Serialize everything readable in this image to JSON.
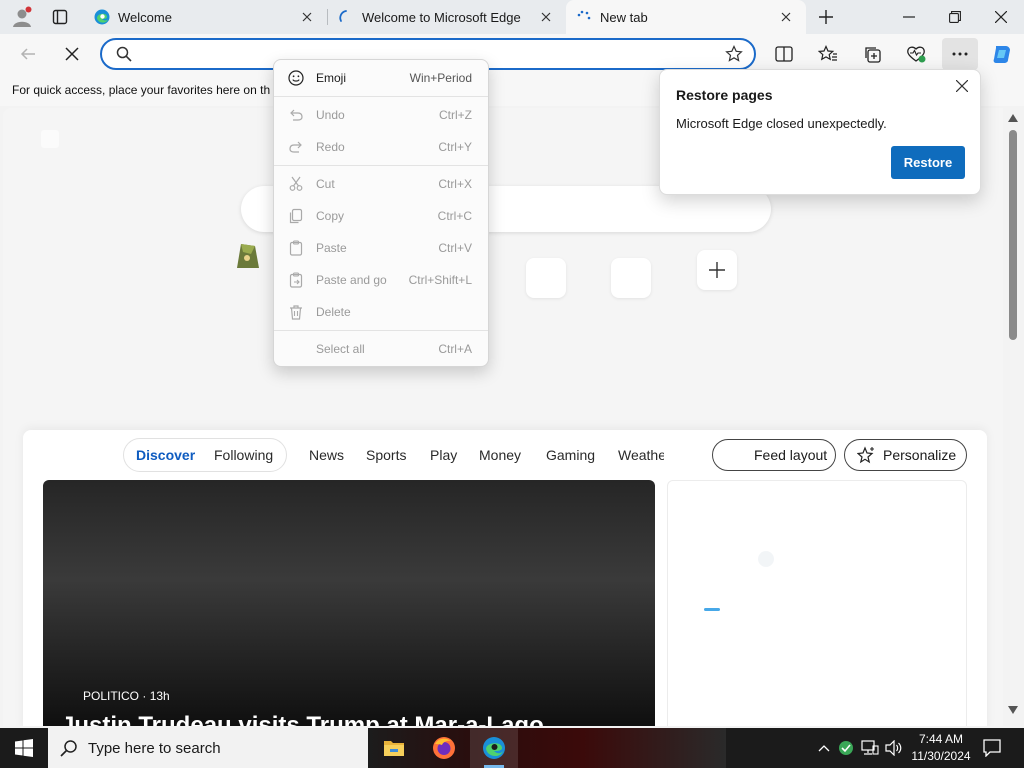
{
  "tabs": [
    {
      "title": "Welcome",
      "icon": "edge-icon"
    },
    {
      "title": "Welcome to Microsoft Edge",
      "icon": "loading-icon"
    },
    {
      "title": "New tab",
      "icon": "loading-icon"
    }
  ],
  "address_bar": {
    "value": "",
    "placeholder": ""
  },
  "favorites_bar": {
    "text": "For quick access, place your favorites here on th"
  },
  "context_menu": {
    "items": [
      {
        "label": "Emoji",
        "shortcut": "Win+Period",
        "icon": "emoji-icon",
        "enabled": true
      },
      {
        "label": "Undo",
        "shortcut": "Ctrl+Z",
        "icon": "undo-icon",
        "enabled": false
      },
      {
        "label": "Redo",
        "shortcut": "Ctrl+Y",
        "icon": "redo-icon",
        "enabled": false
      },
      {
        "label": "Cut",
        "shortcut": "Ctrl+X",
        "icon": "cut-icon",
        "enabled": false
      },
      {
        "label": "Copy",
        "shortcut": "Ctrl+C",
        "icon": "copy-icon",
        "enabled": false
      },
      {
        "label": "Paste",
        "shortcut": "Ctrl+V",
        "icon": "paste-icon",
        "enabled": false
      },
      {
        "label": "Paste and go",
        "shortcut": "Ctrl+Shift+L",
        "icon": "paste-go-icon",
        "enabled": false
      },
      {
        "label": "Delete",
        "shortcut": "",
        "icon": "delete-icon",
        "enabled": false
      },
      {
        "label": "Select all",
        "shortcut": "Ctrl+A",
        "icon": "",
        "enabled": false
      }
    ]
  },
  "restore_popup": {
    "title": "Restore pages",
    "message": "Microsoft Edge closed unexpectedly.",
    "button": "Restore"
  },
  "feed": {
    "tabs": [
      "Discover",
      "Following",
      "News",
      "Sports",
      "Play",
      "Money",
      "Gaming",
      "Weathe"
    ],
    "active_tab": "Discover",
    "layout_button": "Feed layout",
    "personalize_button": "Personalize",
    "hero": {
      "source": "POLITICO",
      "age": "13h",
      "headline": "Justin Trudeau visits Trump at Mar-a-Lago"
    }
  },
  "taskbar": {
    "search_placeholder": "Type here to search",
    "time": "7:44 AM",
    "date": "11/30/2024",
    "pinned": [
      "file-explorer-icon",
      "firefox-icon",
      "edge-icon"
    ]
  },
  "colors": {
    "accent": "#0f6cbd",
    "address_focus": "#1b6ac9",
    "feed_active": "#0f5cc0",
    "taskbar": "#1b1b1b"
  }
}
